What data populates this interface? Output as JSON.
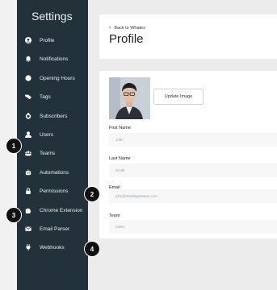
{
  "sidebar": {
    "title": "Settings",
    "items": [
      {
        "label": "Profile",
        "icon": "user-circle-icon"
      },
      {
        "label": "Notifications",
        "icon": "bell-icon"
      },
      {
        "label": "Opening Hours",
        "icon": "clock-icon"
      },
      {
        "label": "Tags",
        "icon": "tag-icon"
      },
      {
        "label": "Subscribers",
        "icon": "subscribers-icon"
      },
      {
        "label": "Users",
        "icon": "user-icon"
      },
      {
        "label": "Teams",
        "icon": "team-icon"
      },
      {
        "label": "Automations",
        "icon": "robot-icon"
      },
      {
        "label": "Permissions",
        "icon": "lock-icon"
      },
      {
        "label": "Chrome Extension",
        "icon": "puzzle-icon"
      },
      {
        "label": "Email Parser",
        "icon": "envelope-icon"
      },
      {
        "label": "Webhooks",
        "icon": "plug-icon"
      }
    ]
  },
  "header": {
    "back_label": "Back to Whatex",
    "title": "Profile"
  },
  "profile": {
    "update_image_label": "Update Image",
    "fields": {
      "first_name": {
        "label": "First Name",
        "value": "John"
      },
      "last_name": {
        "label": "Last Name",
        "value": "Smith"
      },
      "email": {
        "label": "Email",
        "value": "john@sterlingestates.com"
      },
      "team": {
        "label": "Team",
        "value": "Sales"
      }
    }
  },
  "badges": [
    "1",
    "2",
    "3",
    "4"
  ],
  "colors": {
    "sidebar_bg": "#23313b",
    "content_bg": "#ececec",
    "badge_bg": "#111111"
  }
}
